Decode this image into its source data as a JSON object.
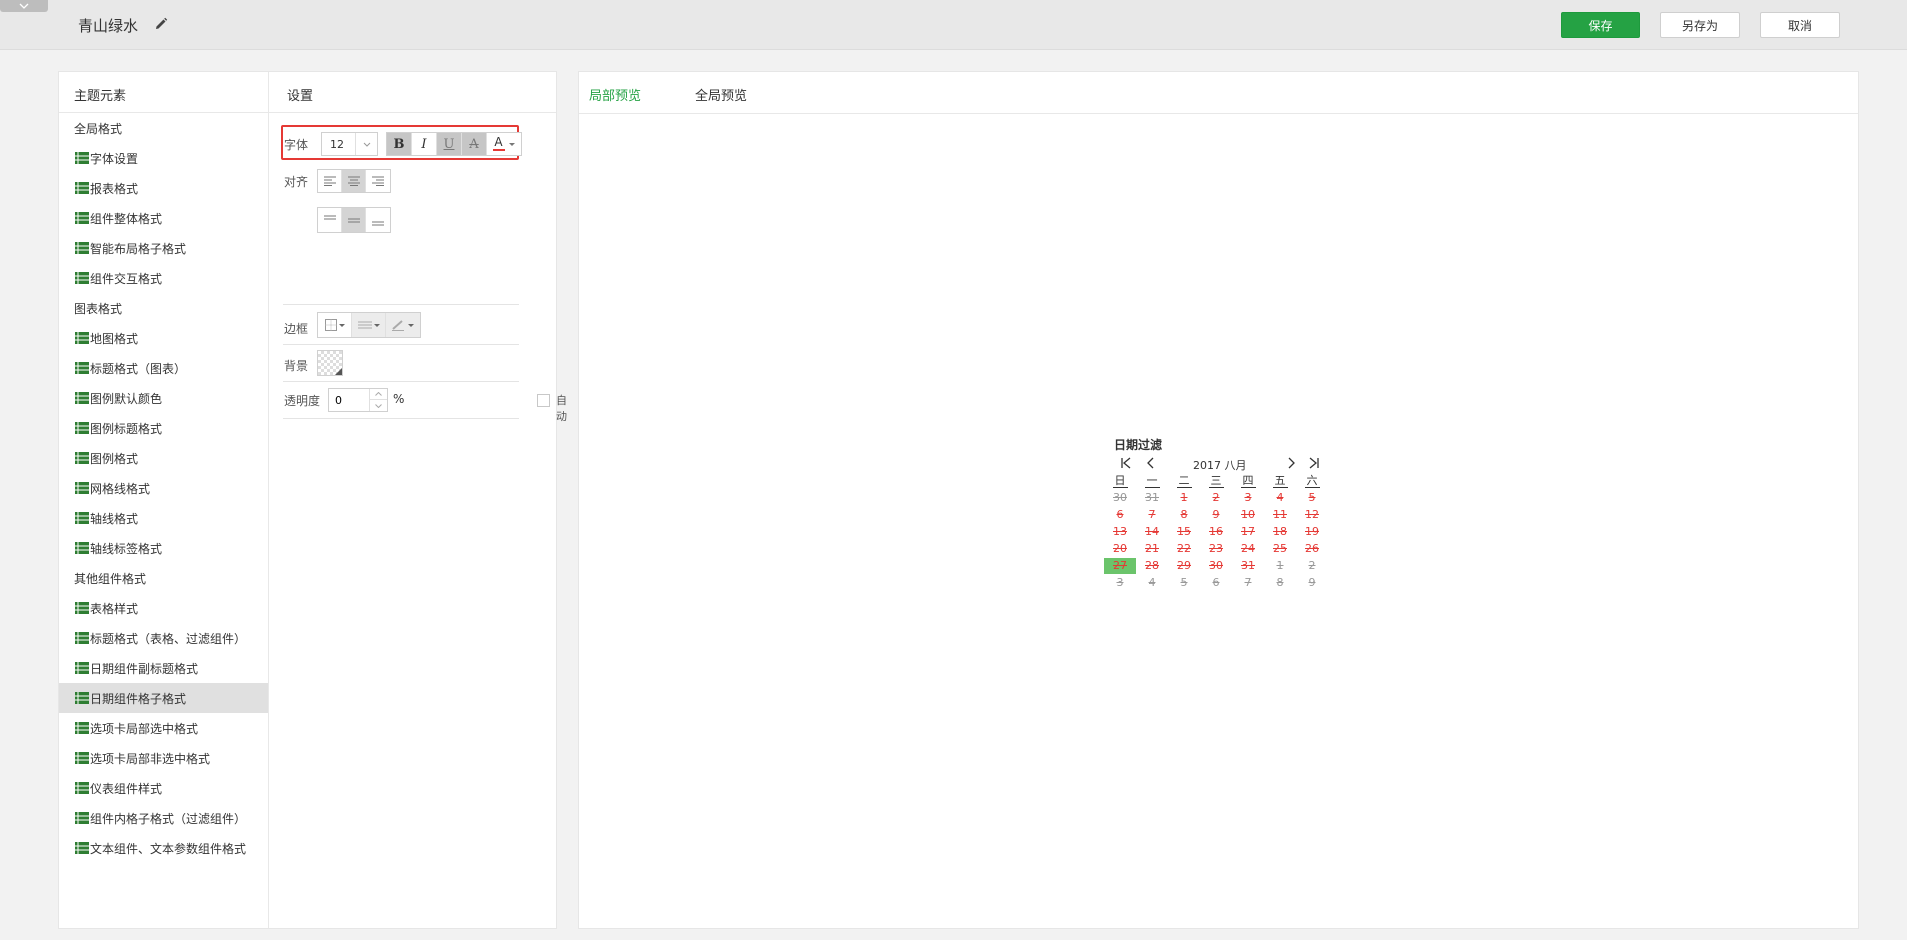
{
  "header": {
    "title": "青山绿水",
    "save_label": "保存",
    "saveas_label": "另存为",
    "cancel_label": "取消"
  },
  "left_panel": {
    "elements_header": "主题元素",
    "settings_header": "设置",
    "tree": [
      {
        "label": "全局格式",
        "type": "group"
      },
      {
        "label": "字体设置",
        "type": "child"
      },
      {
        "label": "报表格式",
        "type": "child"
      },
      {
        "label": "组件整体格式",
        "type": "child"
      },
      {
        "label": "智能布局格子格式",
        "type": "child"
      },
      {
        "label": "组件交互格式",
        "type": "child"
      },
      {
        "label": "图表格式",
        "type": "group"
      },
      {
        "label": "地图格式",
        "type": "child"
      },
      {
        "label": "标题格式（图表）",
        "type": "child"
      },
      {
        "label": "图例默认颜色",
        "type": "child"
      },
      {
        "label": "图例标题格式",
        "type": "child"
      },
      {
        "label": "图例格式",
        "type": "child"
      },
      {
        "label": "网格线格式",
        "type": "child"
      },
      {
        "label": "轴线格式",
        "type": "child"
      },
      {
        "label": "轴线标签格式",
        "type": "child"
      },
      {
        "label": "其他组件格式",
        "type": "group"
      },
      {
        "label": "表格样式",
        "type": "child"
      },
      {
        "label": "标题格式（表格、过滤组件）",
        "type": "child"
      },
      {
        "label": "日期组件副标题格式",
        "type": "child"
      },
      {
        "label": "日期组件格子格式",
        "type": "child",
        "selected": true
      },
      {
        "label": "选项卡局部选中格式",
        "type": "child"
      },
      {
        "label": "选项卡局部非选中格式",
        "type": "child"
      },
      {
        "label": "仪表组件样式",
        "type": "child"
      },
      {
        "label": "组件内格子格式（过滤组件）",
        "type": "child"
      },
      {
        "label": "文本组件、文本参数组件格式",
        "type": "child"
      }
    ]
  },
  "settings": {
    "font_label": "字体",
    "font_size": "12",
    "bold_label": "B",
    "italic_label": "I",
    "underline_label": "U",
    "strike_label": "A",
    "color_label": "A",
    "font_color": "#e53935",
    "align_label": "对齐",
    "border_label": "边框",
    "background_label": "背景",
    "opacity_label": "透明度",
    "opacity_value": "0",
    "percent": "%",
    "auto_label": "自动"
  },
  "preview": {
    "tab_local": "局部预览",
    "tab_global": "全局预览",
    "calendar": {
      "title": "日期过滤",
      "month_label": "2017 八月",
      "weekdays": [
        "日",
        "一",
        "二",
        "三",
        "四",
        "五",
        "六"
      ],
      "weeks": [
        [
          "30",
          "31",
          "1",
          "2",
          "3",
          "4",
          "5"
        ],
        [
          "6",
          "7",
          "8",
          "9",
          "10",
          "11",
          "12"
        ],
        [
          "13",
          "14",
          "15",
          "16",
          "17",
          "18",
          "19"
        ],
        [
          "20",
          "21",
          "22",
          "23",
          "24",
          "25",
          "26"
        ],
        [
          "27",
          "28",
          "29",
          "30",
          "31",
          "1",
          "2"
        ],
        [
          "3",
          "4",
          "5",
          "6",
          "7",
          "8",
          "9"
        ]
      ],
      "selected_day": "27"
    }
  },
  "colors": {
    "accent": "#25a244",
    "selected_day_bg": "#6bc46b",
    "crossed_day": "#e53935",
    "highlight_box": "#e53935"
  }
}
